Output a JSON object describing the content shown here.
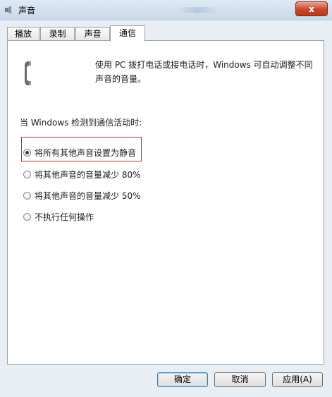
{
  "window": {
    "title": "声音",
    "close_label": "x"
  },
  "tabs": [
    {
      "label": "播放"
    },
    {
      "label": "录制"
    },
    {
      "label": "声音"
    },
    {
      "label": "通信"
    }
  ],
  "active_tab": "通信",
  "communications": {
    "description_line1": "使用 PC 拨打电话或接电话时，Windows 可自动调整不同",
    "description_line2": "声音的音量。",
    "section_label": "当 Windows 检测到通信活动时:",
    "options": [
      {
        "label": "将所有其他声音设置为静音",
        "selected": true
      },
      {
        "label": "将其他声音的音量减少 80%",
        "selected": false
      },
      {
        "label": "将其他声音的音量减少 50%",
        "selected": false
      },
      {
        "label": "不执行任何操作",
        "selected": false
      }
    ]
  },
  "buttons": {
    "ok": "确定",
    "cancel": "取消",
    "apply": "应用(A)"
  },
  "colors": {
    "highlight_border": "#c8302c",
    "close_button": "#c9452c"
  },
  "icons": [
    "speaker-icon",
    "phone-icon",
    "close-icon"
  ]
}
